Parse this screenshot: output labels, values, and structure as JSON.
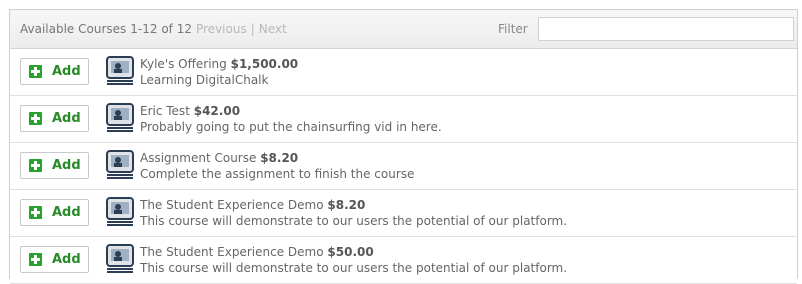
{
  "header": {
    "title": "Available Courses",
    "range": "1-12 of 12",
    "previous": "Previous",
    "separator": "|",
    "next": "Next",
    "filter_label": "Filter",
    "filter_value": ""
  },
  "add_label": "Add",
  "icons": {
    "add": "plus-square-icon",
    "course": "presentation-screen-icon"
  },
  "colors": {
    "add_green": "#27a22d",
    "add_text": "#2a8a2a",
    "pager_disabled": "#b8b8b8"
  },
  "courses": [
    {
      "name": "Kyle's Offering",
      "price": "$1,500.00",
      "description": "Learning DigitalChalk"
    },
    {
      "name": "Eric Test",
      "price": "$42.00",
      "description": "Probably going to put the chainsurfing vid in here."
    },
    {
      "name": "Assignment Course",
      "price": "$8.20",
      "description": "Complete the assignment to finish the course"
    },
    {
      "name": "The Student Experience Demo",
      "price": "$8.20",
      "description": "This course will demonstrate to our users the potential of our platform."
    },
    {
      "name": "The Student Experience Demo",
      "price": "$50.00",
      "description": "This course will demonstrate to our users the potential of our platform."
    }
  ]
}
